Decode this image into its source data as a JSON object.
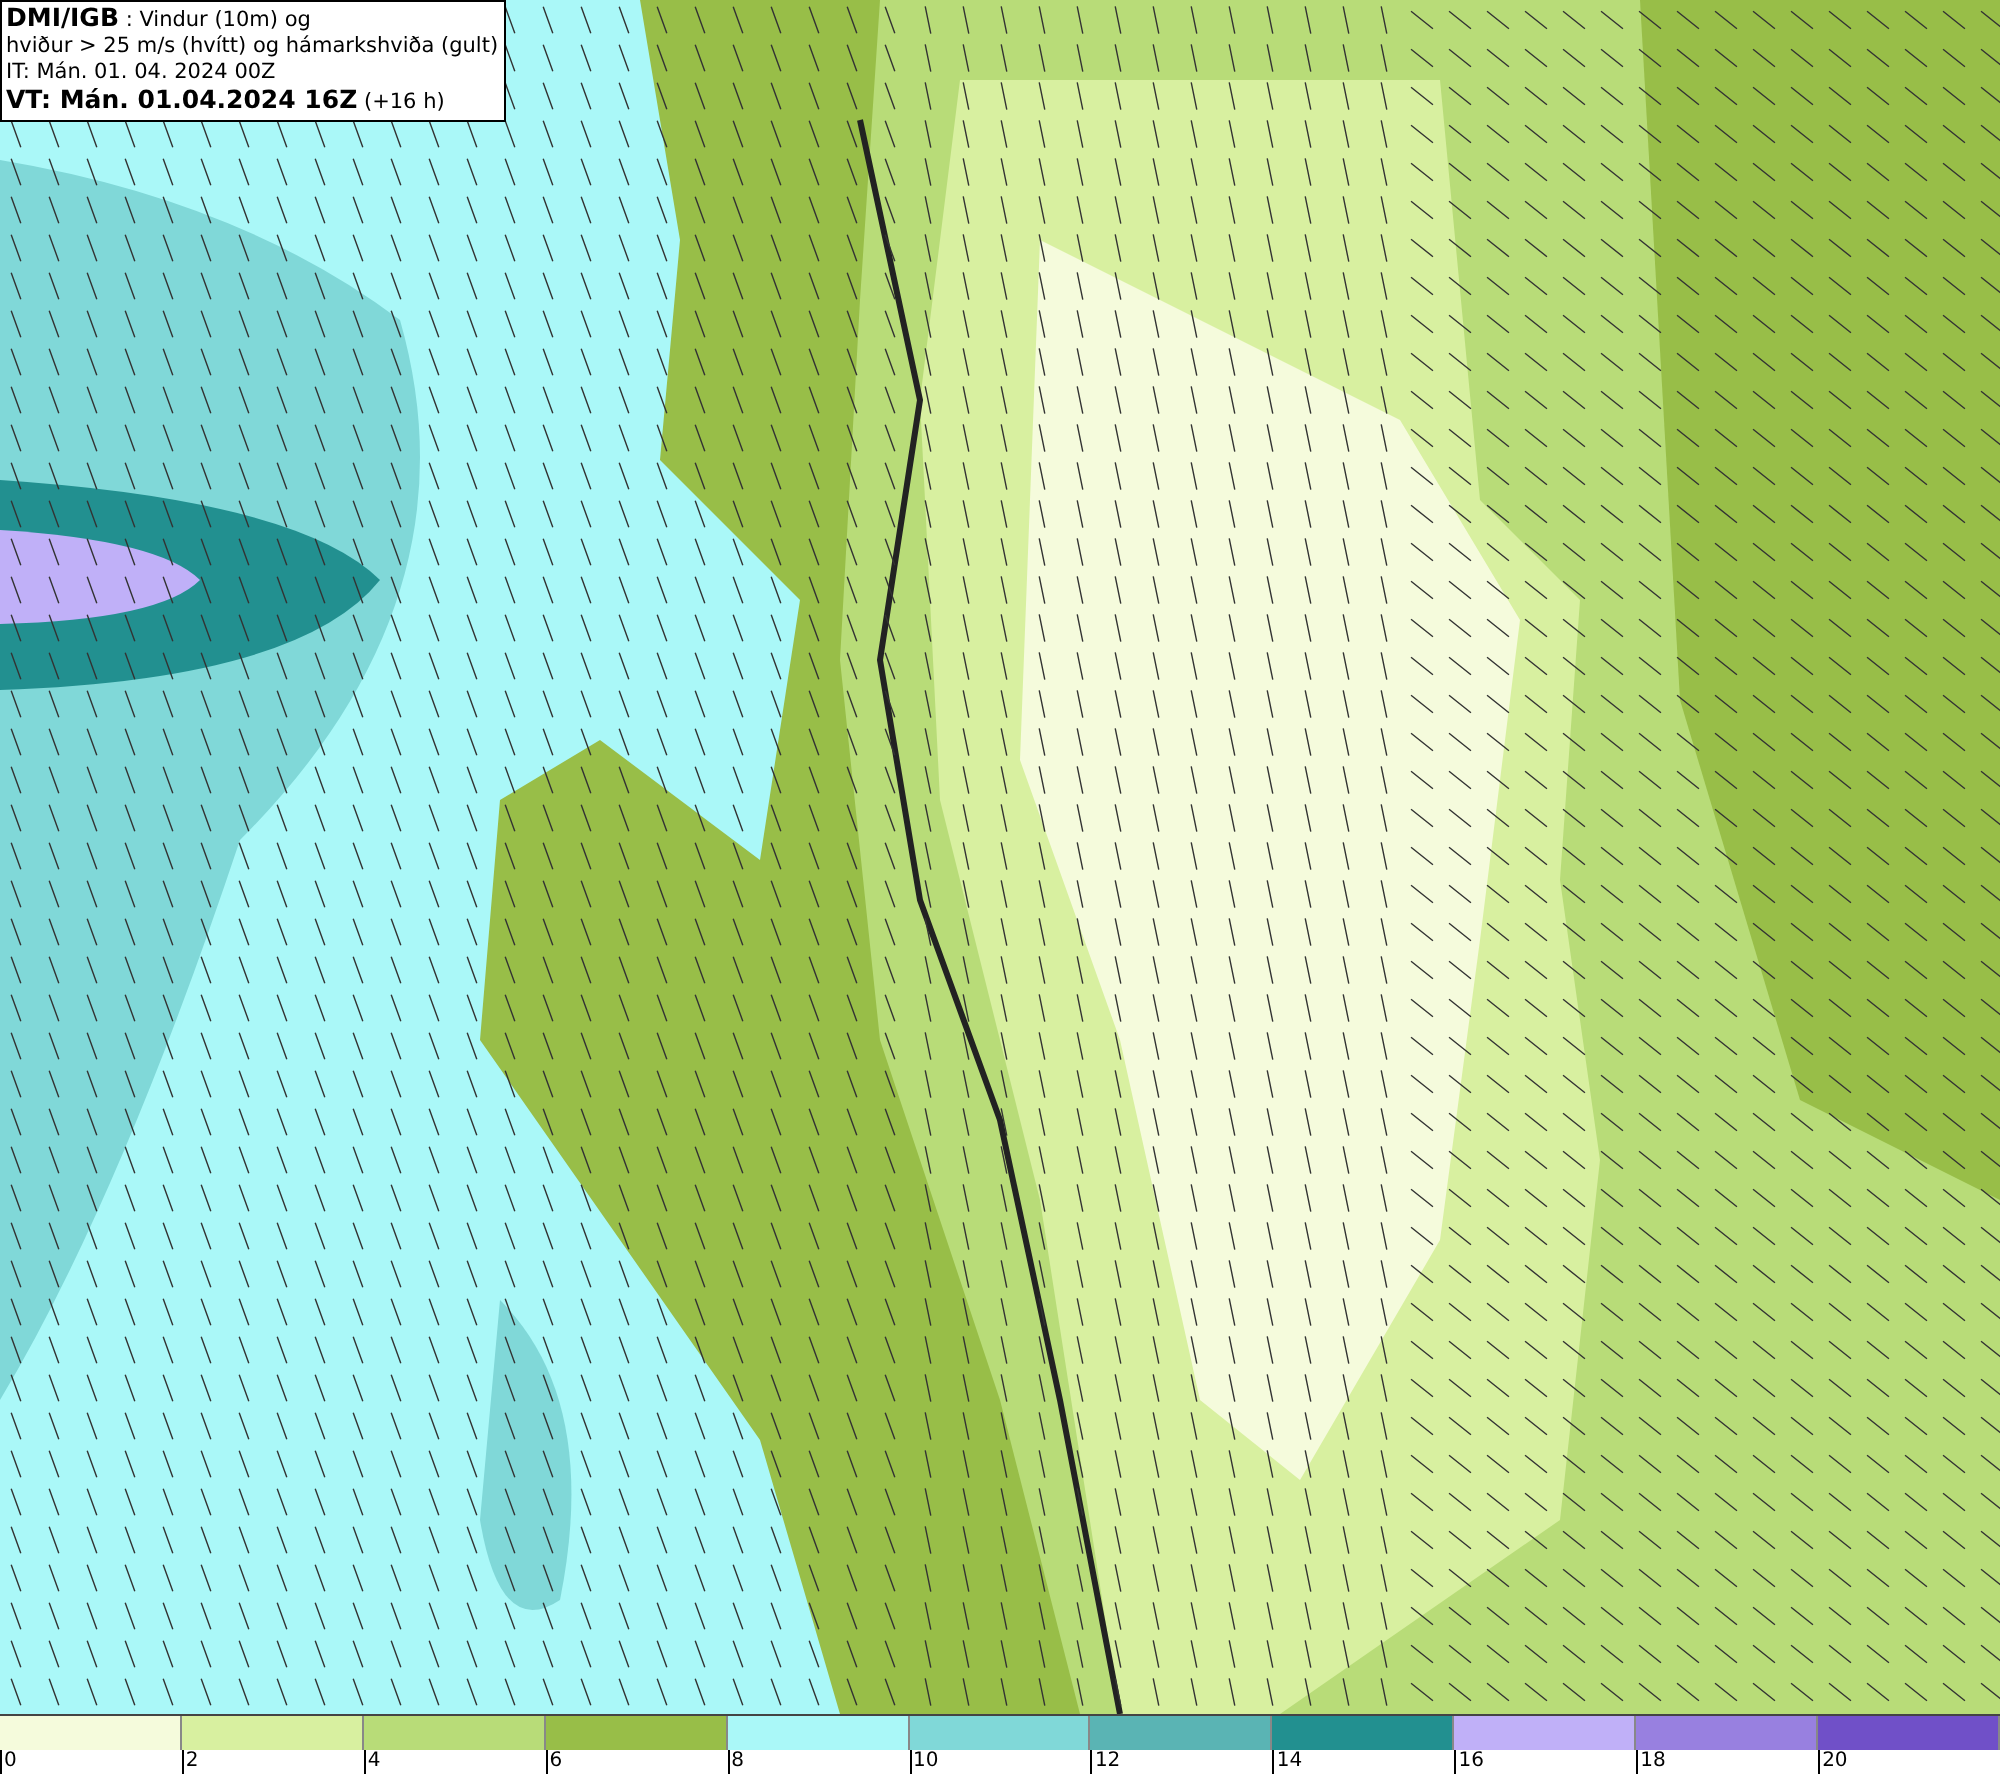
{
  "title_box": {
    "lines": [
      "**DMI/IGB** : Vindur (10m) og",
      "hviður > 25 m/s (hvítt) og hámarkshviða (gult)",
      "IT: Mán. 01. 04. 2024 00Z",
      "**VT: Mán. 01.04.2024 16Z** (+16 h)"
    ]
  },
  "legend": [
    {
      "label": "0",
      "color": "#f5fbdc"
    },
    {
      "label": "2",
      "color": "#d8f0a0"
    },
    {
      "label": "4",
      "color": "#b8dc78"
    },
    {
      "label": "6",
      "color": "#98be48"
    },
    {
      "label": "8",
      "color": "#aaf8f8"
    },
    {
      "label": "10",
      "color": "#80d8d8"
    },
    {
      "label": "12",
      "color": "#5ab4b4"
    },
    {
      "label": "14",
      "color": "#229090"
    },
    {
      "label": "16",
      "color": "#c0b0f8"
    },
    {
      "label": "18",
      "color": "#9880e0"
    },
    {
      "label": "20",
      "color": "#7050c8"
    }
  ]
}
